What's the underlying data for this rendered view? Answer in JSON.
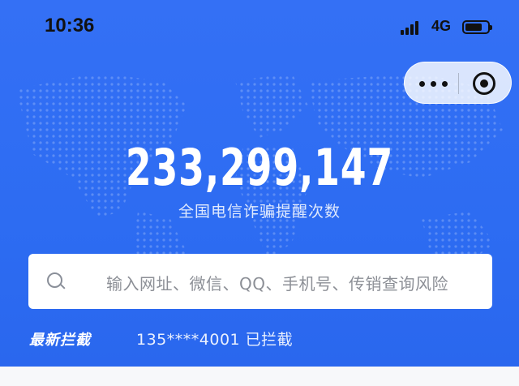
{
  "status_bar": {
    "time": "10:36",
    "network": "4G",
    "icons": [
      "signal-icon",
      "battery-icon"
    ]
  },
  "capsule": {
    "icons": [
      "more-dots-icon",
      "close-target-icon"
    ]
  },
  "hero": {
    "count": "233,299,147",
    "subtitle": "全国电信诈骗提醒次数",
    "background_color": "#2d6cf2"
  },
  "search": {
    "placeholder": "输入网址、微信、QQ、手机号、传销查询风险",
    "icon": "search-icon"
  },
  "latest": {
    "label": "最新拦截",
    "text": "135****4001 已拦截"
  }
}
